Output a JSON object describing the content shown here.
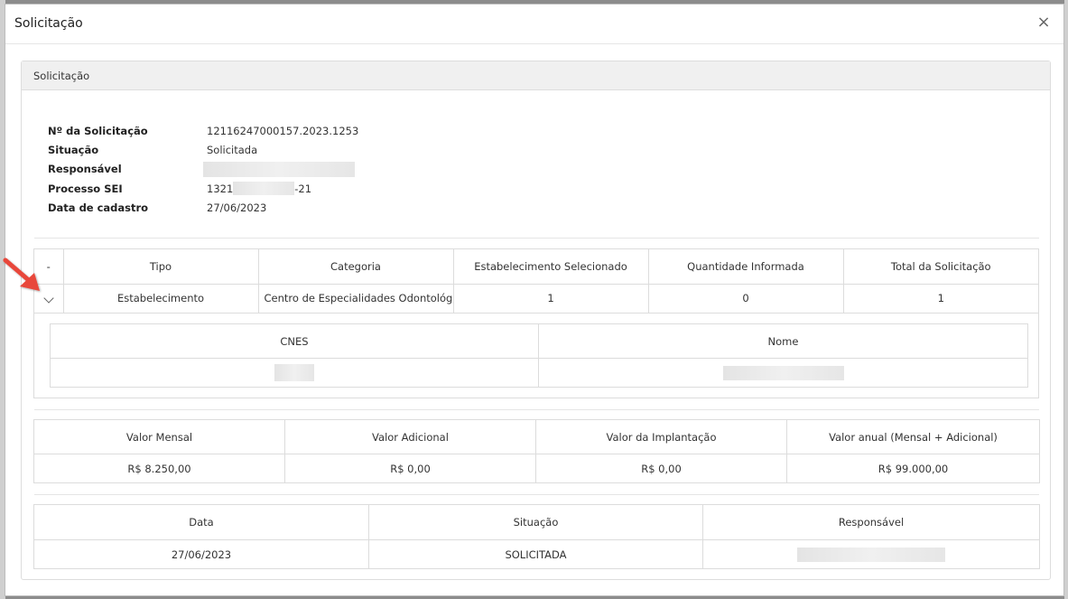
{
  "modal": {
    "title": "Solicitação",
    "close_icon": "×"
  },
  "panel": {
    "heading": "Solicitação"
  },
  "info": {
    "numero_label": "Nº da Solicitação",
    "numero_value": "12116247000157.2023.1253",
    "situacao_label": "Situação",
    "situacao_value": "Solicitada",
    "responsavel_label": "Responsável",
    "processo_label": "Processo SEI",
    "processo_prefix": "1321",
    "processo_suffix": "-21",
    "data_label": "Data de cadastro",
    "data_value": "27/06/2023"
  },
  "request_table": {
    "headers": [
      "-",
      "Tipo",
      "Categoria",
      "Estabelecimento Selecionado",
      "Quantidade Informada",
      "Total da Solicitação"
    ],
    "row": [
      "Estabelecimento",
      "Centro de Especialidades Odontológicas I",
      "1",
      "0",
      "1"
    ]
  },
  "cnes_table": {
    "headers": [
      "CNES",
      "Nome"
    ]
  },
  "valores_table": {
    "headers": [
      "Valor Mensal",
      "Valor Adicional",
      "Valor da Implantação",
      "Valor anual (Mensal + Adicional)"
    ],
    "row": [
      "R$ 8.250,00",
      "R$ 0,00",
      "R$ 0,00",
      "R$ 99.000,00"
    ]
  },
  "historico_table": {
    "headers": [
      "Data",
      "Situação",
      "Responsável"
    ],
    "row": [
      "27/06/2023",
      "SOLICITADA"
    ]
  },
  "colors": {
    "arrow": "#e8463a"
  }
}
